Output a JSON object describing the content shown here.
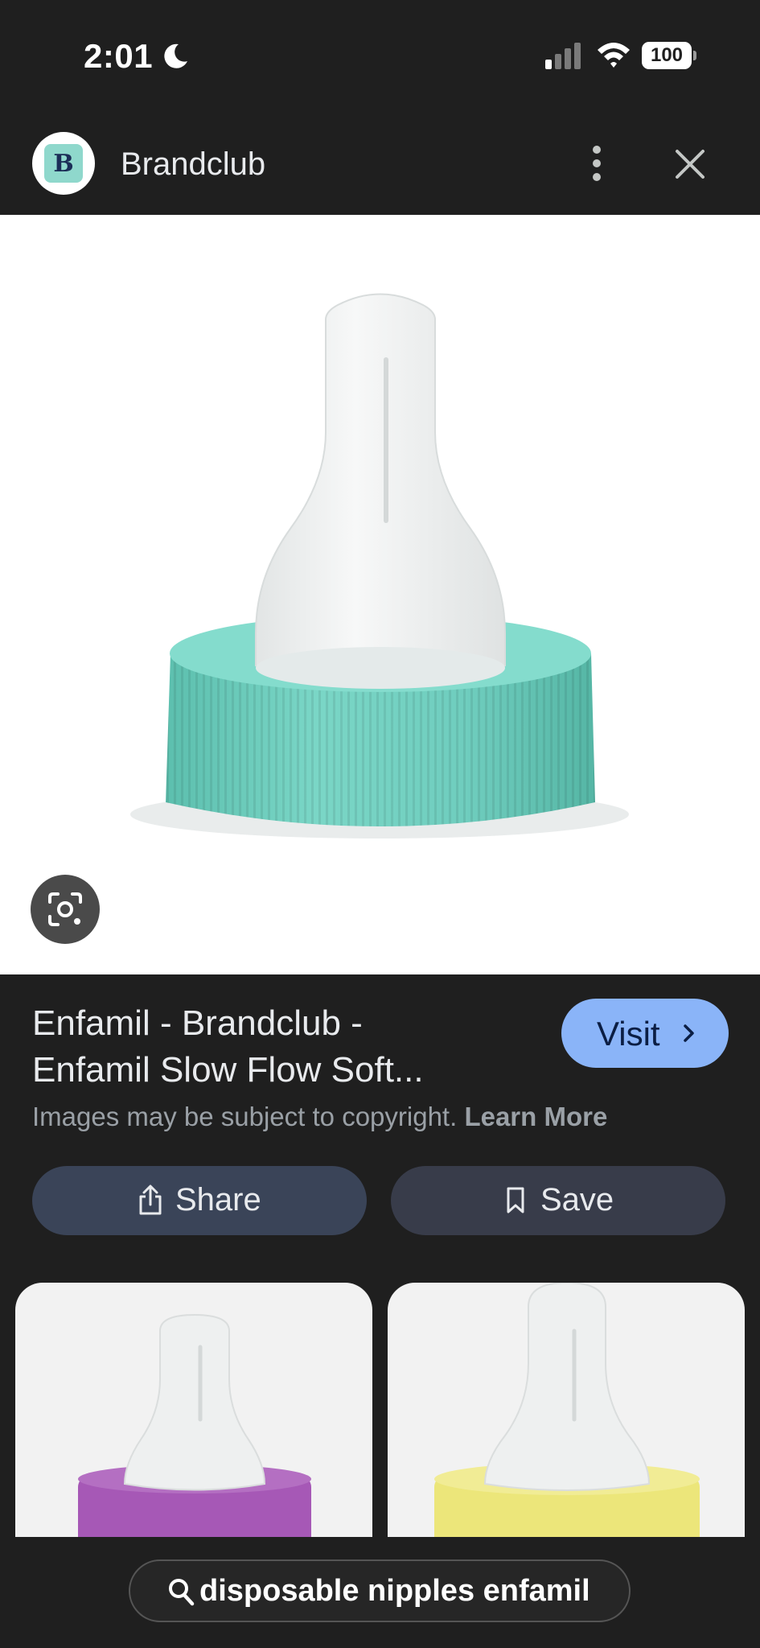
{
  "status_bar": {
    "time": "2:01",
    "battery": "100",
    "icons": [
      "moon-icon",
      "signal-icon",
      "wifi-icon",
      "battery-icon"
    ]
  },
  "header": {
    "avatar_letter": "B",
    "site_name": "Brandclub",
    "icons": [
      "more-vert-icon",
      "close-icon"
    ]
  },
  "result": {
    "title": "Enfamil - Brandclub - Enfamil Slow Flow Soft...",
    "visit_label": "Visit",
    "copyright_text": "Images may be subject to copyright.",
    "learn_more": "Learn More",
    "share_label": "Share",
    "save_label": "Save"
  },
  "related": {
    "items": [
      {
        "cap_color": "#a658b6"
      },
      {
        "cap_color": "#ece67a"
      }
    ]
  },
  "search": {
    "query": "disposable nipples enfamil"
  },
  "colors": {
    "background": "#1f1f1f",
    "visit_button": "#8ab4f8",
    "share_button": "#3a4458",
    "save_button": "#383c4a",
    "main_cap": "#6fcdbe",
    "avatar_tile": "#8fd8cc"
  }
}
